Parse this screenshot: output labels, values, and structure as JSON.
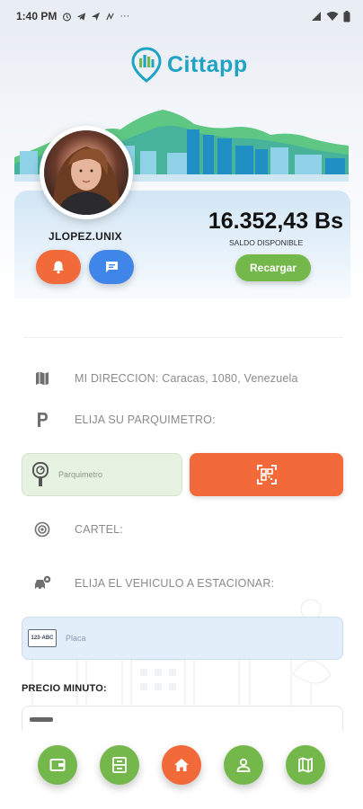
{
  "status_bar": {
    "time": "1:40 PM",
    "more": "···"
  },
  "app": {
    "name": "Cittapp"
  },
  "profile": {
    "username": "JLOPEZ.UNIX",
    "balance": "16.352,43 Bs",
    "balance_label": "SALDO DISPONIBLE",
    "recharge_label": "Recargar"
  },
  "form": {
    "address_label": "MI DIRECCION: Caracas, 1080, Venezuela",
    "parking_meter_label": "ELIJA SU PARQUIMETRO:",
    "parking_meter_placeholder": "Parquimetro",
    "sign_label": "CARTEL:",
    "vehicle_label": "ELIJA EL VEHICULO A ESTACIONAR:",
    "plate_icon_text": "123·ABC",
    "plate_placeholder": "Placa",
    "price_label": "PRECIO MINUTO:"
  },
  "bottom_nav": [
    "wallet",
    "parking-meter",
    "home",
    "profile",
    "map"
  ],
  "colors": {
    "brand": "#1fa3c4",
    "green": "#74b84c",
    "orange": "#f26a39",
    "blue": "#3f86e8"
  }
}
